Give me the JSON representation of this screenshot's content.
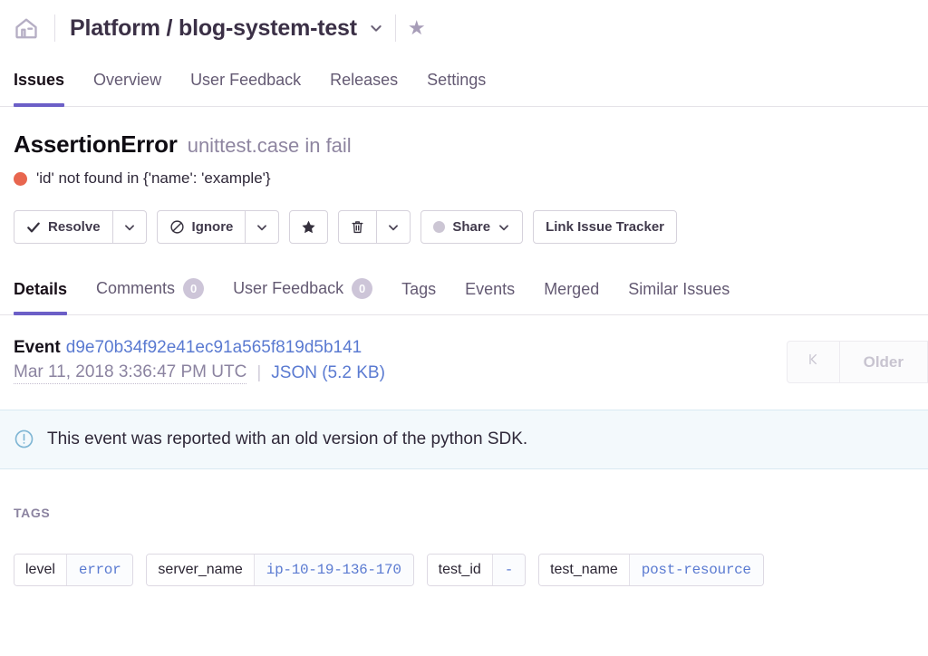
{
  "header": {
    "home_icon": "home-icon",
    "project_title": "Platform / blog-system-test",
    "dropdown_icon": "chevron-down-icon",
    "bookmark_icon": "star-icon"
  },
  "main_nav": {
    "items": [
      {
        "label": "Issues",
        "active": true
      },
      {
        "label": "Overview",
        "active": false
      },
      {
        "label": "User Feedback",
        "active": false
      },
      {
        "label": "Releases",
        "active": false
      },
      {
        "label": "Settings",
        "active": false
      }
    ]
  },
  "issue": {
    "type": "AssertionError",
    "culprit": "unittest.case in fail",
    "level_color": "#e8664f",
    "message": "'id' not found in {'name': 'example'}"
  },
  "actions": {
    "resolve_label": "Resolve",
    "resolve_icon": "check-icon",
    "resolve_caret_icon": "chevron-down-icon",
    "ignore_label": "Ignore",
    "ignore_icon": "circle-slash-icon",
    "ignore_caret_icon": "chevron-down-icon",
    "star_icon": "star-icon",
    "delete_icon": "trash-icon",
    "delete_caret_icon": "chevron-down-icon",
    "share_label": "Share",
    "share_icon": "circle-icon",
    "share_caret_icon": "chevron-down-icon",
    "link_issue_tracker_label": "Link Issue Tracker"
  },
  "sub_nav": {
    "items": [
      {
        "label": "Details",
        "count": null,
        "active": true
      },
      {
        "label": "Comments",
        "count": "0",
        "active": false
      },
      {
        "label": "User Feedback",
        "count": "0",
        "active": false
      },
      {
        "label": "Tags",
        "count": null,
        "active": false
      },
      {
        "label": "Events",
        "count": null,
        "active": false
      },
      {
        "label": "Merged",
        "count": null,
        "active": false
      },
      {
        "label": "Similar Issues",
        "count": null,
        "active": false
      }
    ]
  },
  "event": {
    "label": "Event",
    "id": "d9e70b34f92e41ec91a565f819d5b141",
    "timestamp": "Mar 11, 2018 3:36:47 PM UTC",
    "separator": "|",
    "json_link": "JSON (5.2 KB)",
    "pager": {
      "first_icon": "skip-to-first-icon",
      "older_label": "Older"
    }
  },
  "banner": {
    "icon": "info-circle-icon",
    "text": "This event was reported with an old version of the python SDK."
  },
  "tags": {
    "section_label": "TAGS",
    "items": [
      {
        "key": "level",
        "value": "error"
      },
      {
        "key": "server_name",
        "value": "ip-10-19-136-170"
      },
      {
        "key": "test_id",
        "value": "-"
      },
      {
        "key": "test_name",
        "value": "post-resource"
      }
    ]
  }
}
